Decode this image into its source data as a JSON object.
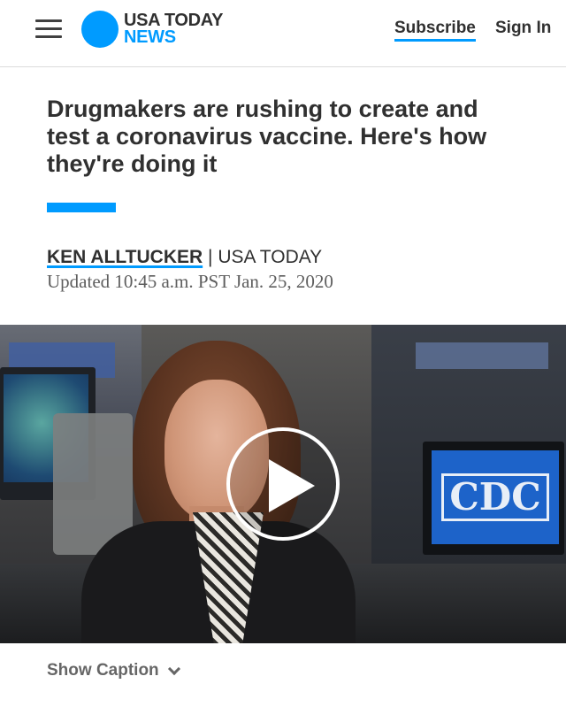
{
  "header": {
    "logo_line1": "USA TODAY",
    "logo_line2": "NEWS",
    "subscribe_label": "Subscribe",
    "signin_label": "Sign In"
  },
  "article": {
    "headline": "Drugmakers are rushing to create and test a coronavirus vaccine. Here's how they're doing it",
    "author": "KEN ALLTUCKER",
    "separator": "|",
    "publication": "USA TODAY",
    "updated": "Updated 10:45 a.m. PST Jan. 25, 2020"
  },
  "video": {
    "screen_text": "CDC",
    "play_icon": "play-icon"
  },
  "caption": {
    "toggle_label": "Show Caption",
    "toggle_icon": "chevron-down-icon"
  },
  "colors": {
    "brand_blue": "#009bff",
    "text_dark": "#303030",
    "text_muted": "#666666"
  }
}
